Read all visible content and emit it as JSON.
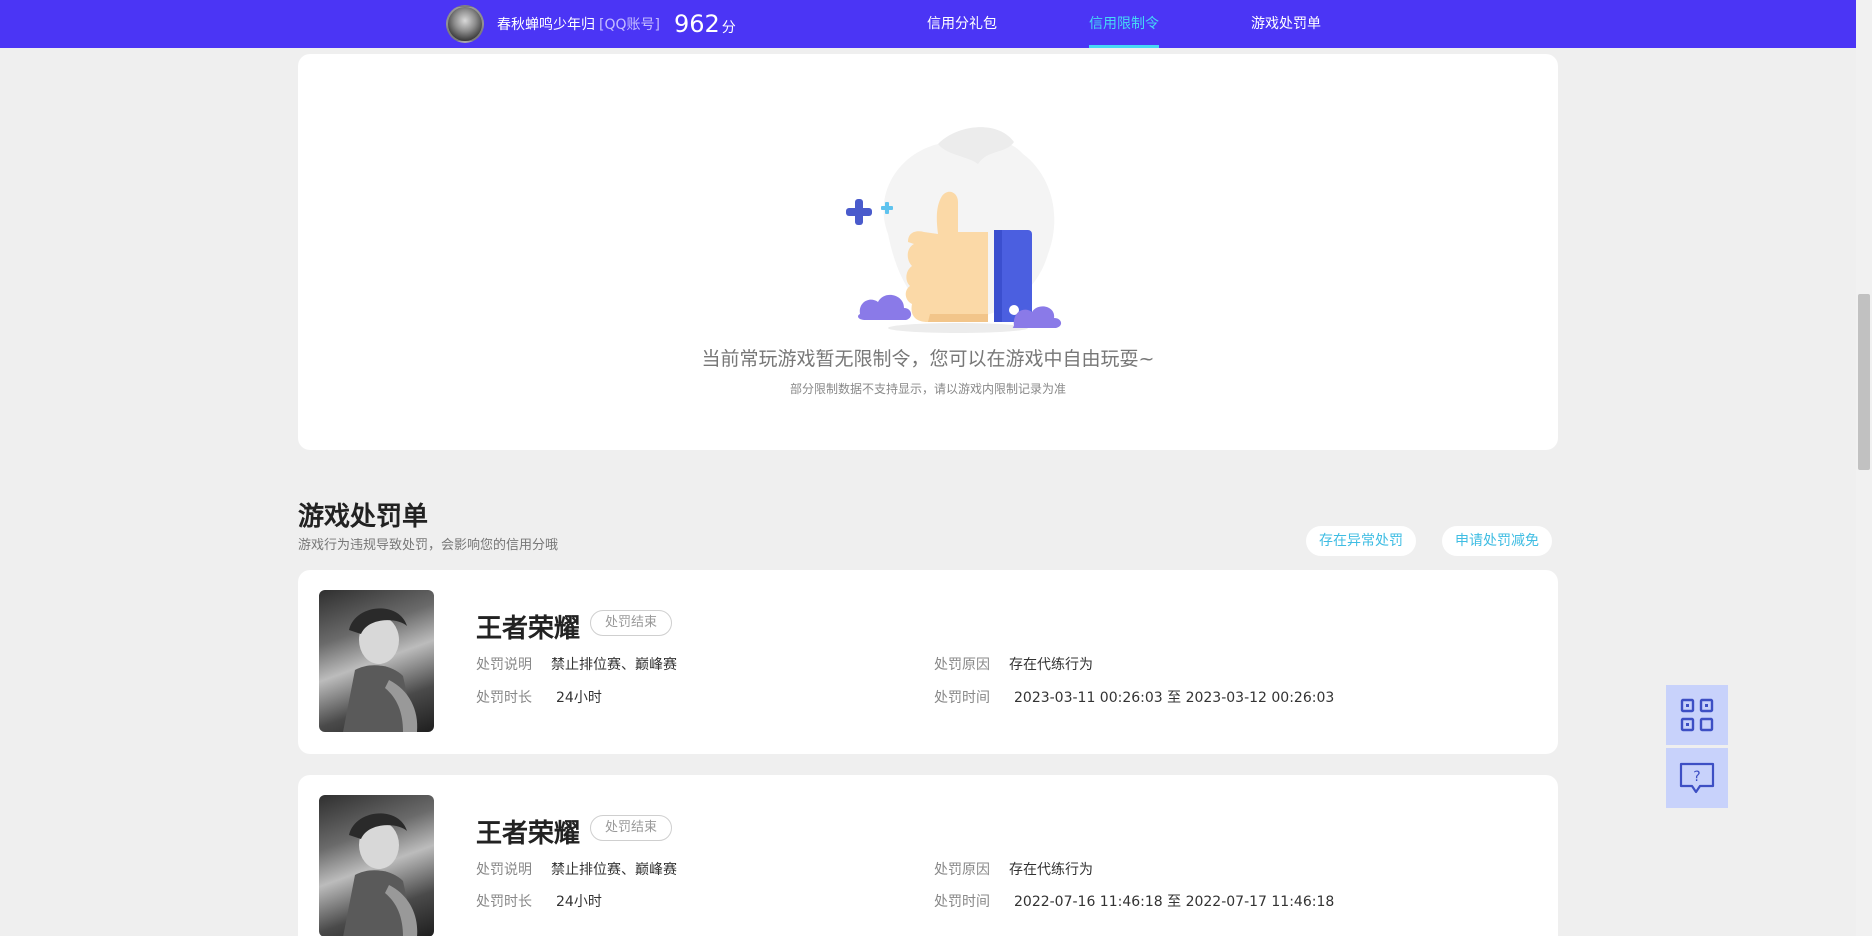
{
  "header": {
    "username": "春秋蝉鸣少年归",
    "account_type": "[QQ账号]",
    "score": "962",
    "score_unit": "分",
    "nav": [
      {
        "label": "信用分礼包"
      },
      {
        "label": "信用限制令"
      },
      {
        "label": "游戏处罚单"
      }
    ],
    "active_nav": "信用限制令"
  },
  "restriction": {
    "message": "当前常玩游戏暂无限制令，您可以在游戏中自由玩耍~",
    "submessage": "部分限制数据不支持显示，请以游戏内限制记录为准"
  },
  "penalty_section": {
    "title": "游戏处罚单",
    "subtitle": "游戏行为违规导致处罚，会影响您的信用分哦",
    "actions": [
      {
        "label": "存在异常处罚"
      },
      {
        "label": "申请处罚减免"
      }
    ]
  },
  "penalties": [
    {
      "game": "王者荣耀",
      "status": "处罚结束",
      "desc_label": "处罚说明",
      "desc": "禁止排位赛、巅峰赛",
      "reason_label": "处罚原因",
      "reason": "存在代练行为",
      "duration_label": "处罚时长",
      "duration": "24小时",
      "time_label": "处罚时间",
      "time": "2023-03-11 00:26:03 至 2023-03-12 00:26:03"
    },
    {
      "game": "王者荣耀",
      "status": "处罚结束",
      "desc_label": "处罚说明",
      "desc": "禁止排位赛、巅峰赛",
      "reason_label": "处罚原因",
      "reason": "存在代练行为",
      "duration_label": "处罚时长",
      "duration": "24小时",
      "time_label": "处罚时间",
      "time": "2022-07-16 11:46:18 至 2022-07-17 11:46:18"
    }
  ],
  "floating_tools": [
    {
      "icon": "qrcode-icon"
    },
    {
      "icon": "help-chat-icon"
    }
  ],
  "colors": {
    "header_bg": "#4b35f5",
    "active_nav": "#46d8f5",
    "accent_link": "#3fbde3",
    "page_bg": "#efefef"
  }
}
